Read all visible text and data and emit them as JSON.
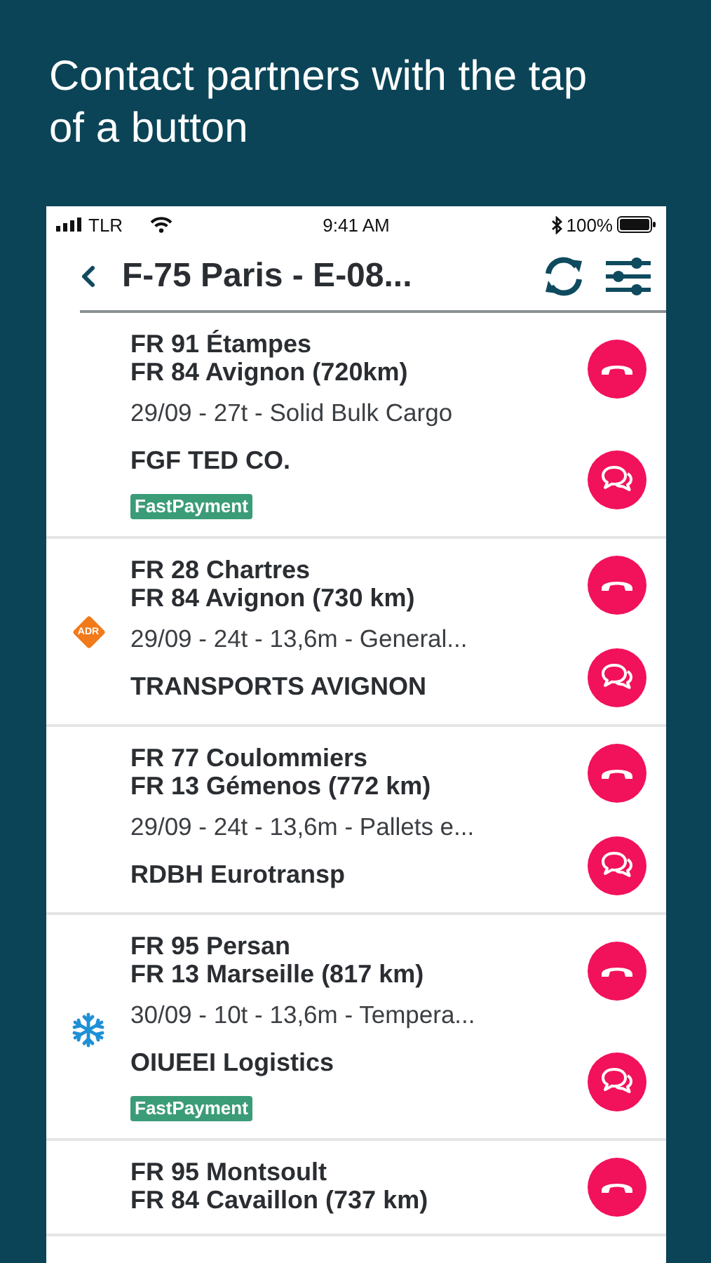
{
  "headline": "Contact partners with the tap of a button",
  "status_bar": {
    "carrier": "TLR",
    "time": "9:41 AM",
    "battery": "100%"
  },
  "header": {
    "title": "F-75 Paris - E-08..."
  },
  "loads": [
    {
      "from": "FR 91 Étampes",
      "to": "FR 84 Avignon (720km)",
      "details": "29/09 - 27t - Solid Bulk Cargo",
      "company": "FGF TED CO.",
      "tag": "FastPayment",
      "actions": [
        {
          "kind": "call"
        },
        {
          "kind": "chat"
        }
      ]
    },
    {
      "from": "FR 28 Chartres",
      "to": "FR 84 Avignon (730 km)",
      "details": "29/09 - 24t - 13,6m - General...",
      "company": "TRANSPORTS AVIGNON",
      "badge": {
        "kind": "adr",
        "text": "ADR"
      },
      "actions": [
        {
          "kind": "call"
        },
        {
          "kind": "chat"
        }
      ]
    },
    {
      "from": "FR 77 Coulommiers",
      "to": "FR 13 Gémenos (772 km)",
      "details": "29/09 - 24t - 13,6m - Pallets e...",
      "company": "RDBH Eurotransp",
      "actions": [
        {
          "kind": "call"
        },
        {
          "kind": "chat"
        }
      ]
    },
    {
      "from": "FR 95 Persan",
      "to": "FR 13 Marseille (817 km)",
      "details": "30/09 - 10t - 13,6m - Tempera...",
      "company": "OIUEEI Logistics",
      "tag": "FastPayment",
      "badge": {
        "kind": "cold"
      },
      "actions": [
        {
          "kind": "call"
        },
        {
          "kind": "chat"
        }
      ]
    },
    {
      "from": "FR 95 Montsoult",
      "to": "FR 84 Cavaillon (737 km)",
      "actions": [
        {
          "kind": "call"
        }
      ]
    }
  ]
}
